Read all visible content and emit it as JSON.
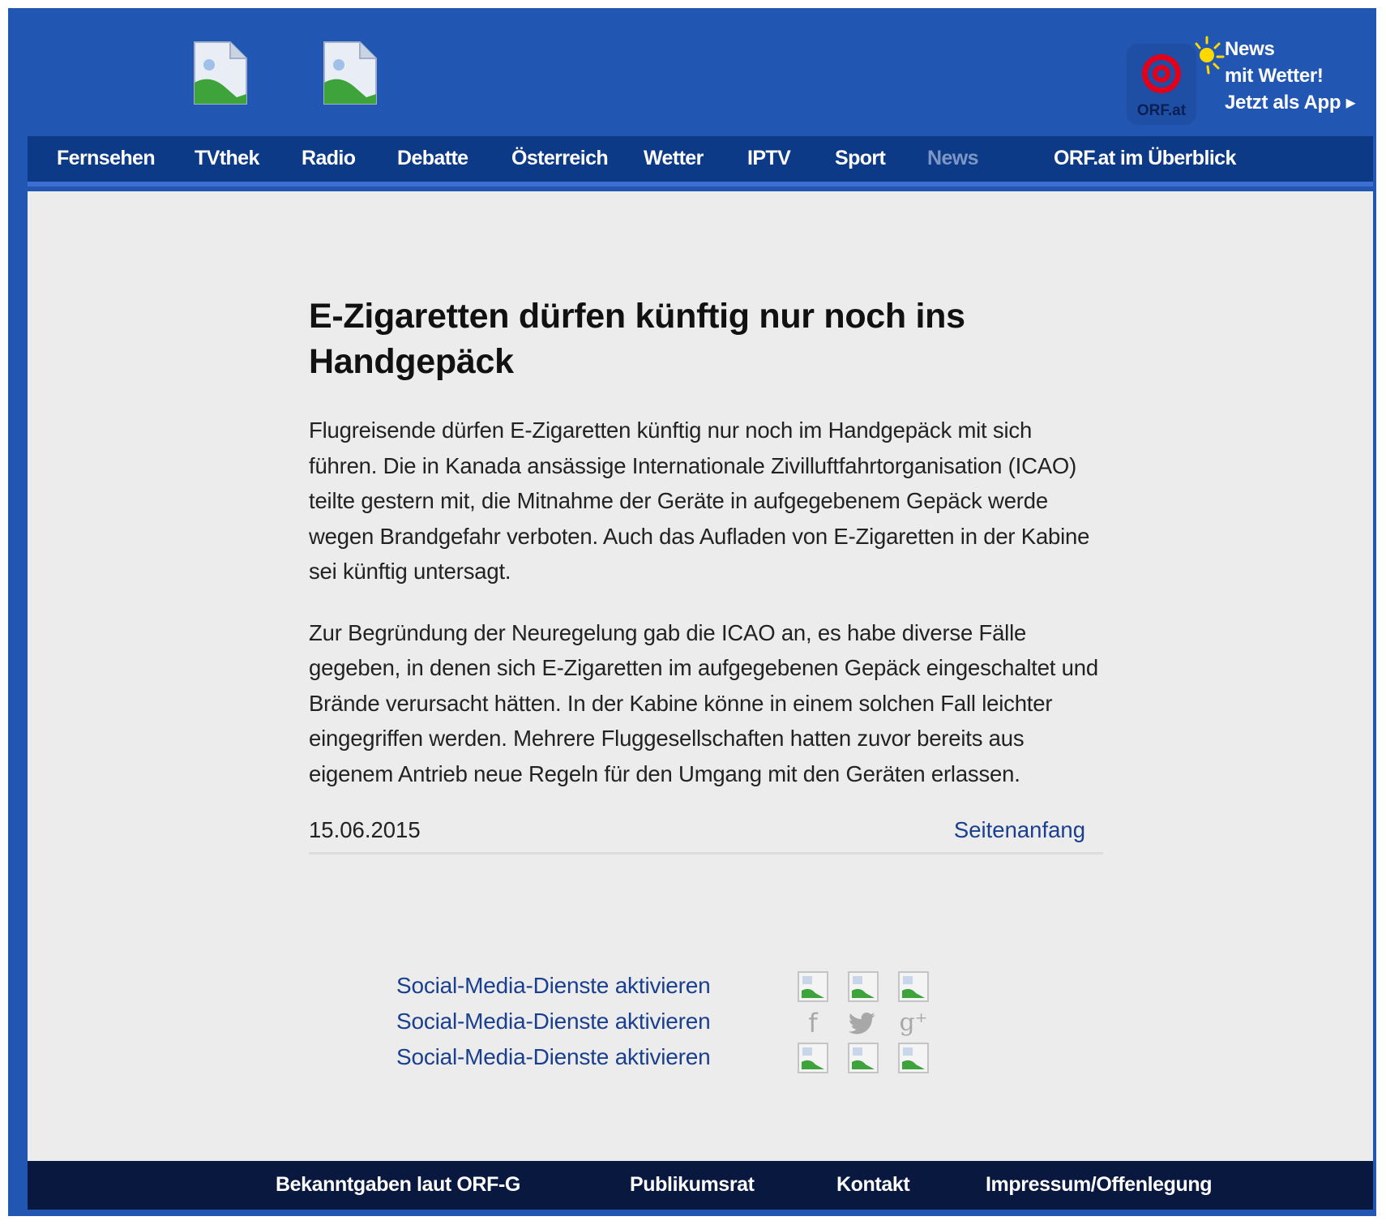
{
  "header": {
    "logo_images": [
      "broken-image-icon",
      "broken-image-icon"
    ],
    "app_promo": {
      "logo_text": "ORF.at",
      "line1": "News",
      "line2": "mit Wetter!",
      "line3": "Jetzt als App ▸"
    }
  },
  "nav": {
    "items": [
      {
        "label": "Fernsehen"
      },
      {
        "label": "TVthek"
      },
      {
        "label": "Radio"
      },
      {
        "label": "Debatte"
      },
      {
        "label": "Österreich"
      },
      {
        "label": "Wetter"
      },
      {
        "label": "IPTV"
      },
      {
        "label": "Sport"
      },
      {
        "label": "News"
      },
      {
        "label": "ORF.at im Überblick"
      }
    ],
    "active": "News"
  },
  "article": {
    "title": "E-Zigaretten dürfen künftig nur noch ins Handgepäck",
    "paragraphs": [
      "Flugreisende dürfen E-Zigaretten künftig nur noch im Handgepäck mit sich führen. Die in Kanada ansässige Internationale Zivilluftfahrtorganisation (ICAO) teilte gestern mit, die Mitnahme der Geräte in aufgegebenem Gepäck werde wegen Brandgefahr verboten. Auch das Aufladen von E-Zigaretten in der Kabine sei künftig untersagt.",
      "Zur Begründung der Neuregelung gab die ICAO an, es habe diverse Fälle gegeben, in denen sich E-Zigaretten im aufgegebenen Gepäck eingeschaltet und Brände verursacht hätten. In der Kabine könne in einem solchen Fall leichter eingegriffen werden. Mehrere Fluggesellschaften hatten zuvor bereits aus eigenem Antrieb neue Regeln für den Umgang mit den Geräten erlassen."
    ],
    "date": "15.06.2015",
    "top_link": "Seitenanfang"
  },
  "social": {
    "rows": [
      {
        "label": "Social-Media-Dienste aktivieren",
        "icons": [
          "broken-image-icon",
          "broken-image-icon",
          "broken-image-icon"
        ]
      },
      {
        "label": "Social-Media-Dienste aktivieren",
        "icons": [
          "facebook-icon",
          "twitter-icon",
          "google-plus-icon"
        ],
        "glyphs": [
          "f",
          "🐦",
          "g⁺"
        ]
      },
      {
        "label": "Social-Media-Dienste aktivieren",
        "icons": [
          "broken-image-icon",
          "broken-image-icon",
          "broken-image-icon"
        ]
      }
    ]
  },
  "footer": {
    "links": [
      {
        "label": "Bekanntgaben laut ORF-G"
      },
      {
        "label": "Publikumsrat"
      },
      {
        "label": "Kontakt"
      },
      {
        "label": "Impressum/Offenlegung"
      }
    ]
  },
  "colors": {
    "frame_blue": "#2157b3",
    "nav_blue": "#0d3a86",
    "footer_navy": "#08183f",
    "content_bg": "#ececec",
    "link_blue": "#1a3f8f",
    "nav_inactive": "#7c96c6"
  }
}
